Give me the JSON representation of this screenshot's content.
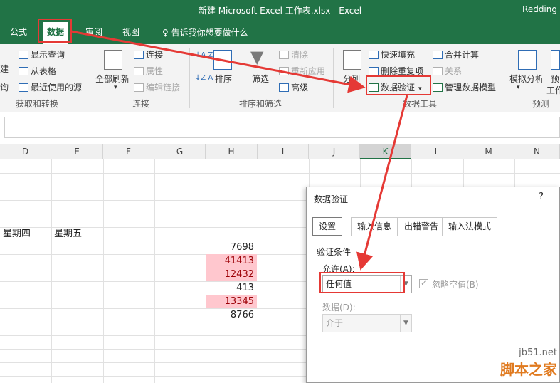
{
  "window": {
    "title": "新建 Microsoft Excel 工作表.xlsx - Excel",
    "user": "Redding"
  },
  "menu": {
    "tabs": [
      "公式",
      "数据",
      "审阅",
      "视图"
    ],
    "tell_me": "告诉我你想要做什么"
  },
  "ribbon": {
    "get_transform": {
      "new_query_partial": "建",
      "query_partial": "询",
      "show_queries": "显示查询",
      "from_table": "从表格",
      "recent_sources": "最近使用的源",
      "group": "获取和转换"
    },
    "connections": {
      "refresh_all": "全部刷新",
      "connections": "连接",
      "properties": "属性",
      "edit_links": "编辑链接",
      "group": "连接"
    },
    "sort_filter": {
      "sort_az": "A↓Z",
      "sort": "排序",
      "filter": "筛选",
      "clear": "清除",
      "reapply": "重新应用",
      "advanced": "高级",
      "group": "排序和筛选"
    },
    "data_tools": {
      "text_to_columns": "分列",
      "flash_fill": "快速填充",
      "remove_duplicates": "删除重复项",
      "data_validation": "数据验证",
      "consolidate": "合并计算",
      "relationships": "关系",
      "manage_data_model": "管理数据模型",
      "group": "数据工具"
    },
    "forecast": {
      "what_if": "模拟分析",
      "forecast_sheet_partial_1": "预",
      "forecast_sheet_partial_2": "工作",
      "group": "预测"
    }
  },
  "grid": {
    "columns": [
      "D",
      "E",
      "F",
      "G",
      "H",
      "I",
      "J",
      "K",
      "L",
      "M",
      "N"
    ],
    "selected_column": "K",
    "headers_row": [
      "星期四",
      "星期五"
    ],
    "h_values": [
      "7698",
      "41413",
      "12432",
      "413",
      "13345",
      "8766"
    ],
    "h_highlighted": [
      false,
      true,
      true,
      false,
      true,
      false
    ]
  },
  "dialog": {
    "title": "数据验证",
    "help": "?",
    "tabs": [
      "设置",
      "输入信息",
      "出错警告",
      "输入法模式"
    ],
    "section": "验证条件",
    "allow_label": "允许(A):",
    "allow_value": "任何值",
    "ignore_blank": "忽略空值(B)",
    "ignore_blank_checked": true,
    "data_label": "数据(D):",
    "data_value": "介于"
  },
  "watermark": {
    "line1": "jb51.net",
    "line2": "脚本之家"
  },
  "colors": {
    "excel_green": "#217346",
    "highlight_red": "#e53935",
    "pink_fill": "#ffc7ce"
  }
}
